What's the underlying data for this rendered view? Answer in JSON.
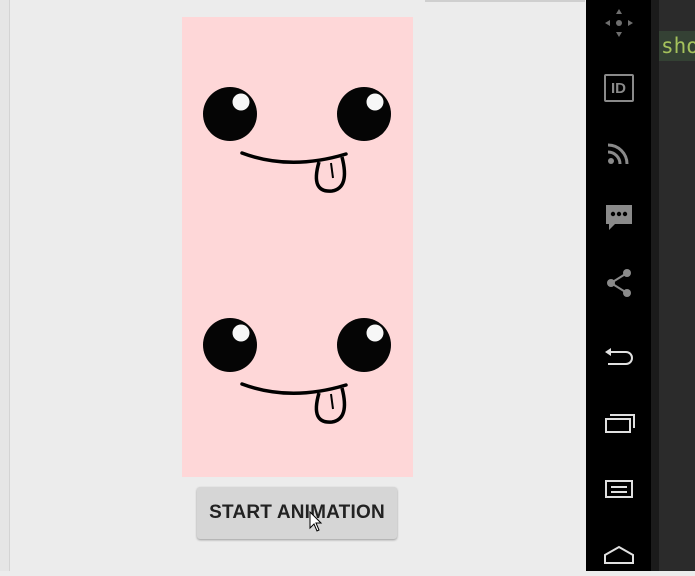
{
  "main": {
    "start_button_label": "START ANIMATION"
  },
  "sidebar": {
    "buttons": [
      {
        "icon": "move-icon"
      },
      {
        "icon": "id-icon",
        "label": "ID"
      },
      {
        "icon": "rss-icon"
      },
      {
        "icon": "sms-icon"
      },
      {
        "icon": "share-icon"
      },
      {
        "icon": "back-icon"
      },
      {
        "icon": "recent-apps-icon"
      },
      {
        "icon": "menu-icon"
      },
      {
        "icon": "home-icon"
      }
    ]
  },
  "editor": {
    "visible_code": "sho"
  },
  "colors": {
    "image_background": "#fed7d8",
    "sidebar": "#000000",
    "code_highlight": "#a5c25c"
  }
}
